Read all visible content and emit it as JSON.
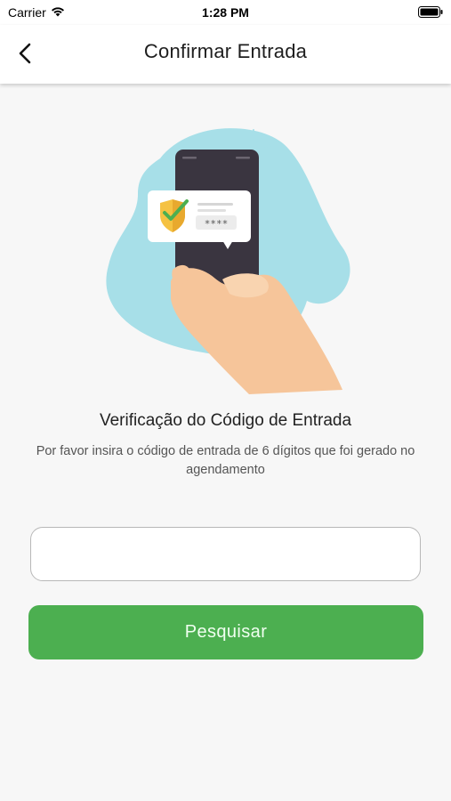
{
  "status_bar": {
    "carrier": "Carrier",
    "time": "1:28 PM",
    "wifi_icon": "wifi-icon",
    "battery_icon": "battery-icon"
  },
  "nav": {
    "back_icon": "chevron-left-icon",
    "title": "Confirmar Entrada"
  },
  "illustration": {
    "name": "phone-verification-illustration",
    "masked_code": "****"
  },
  "content": {
    "heading": "Verificação do Código de Entrada",
    "subtitle": "Por favor insira o código de entrada de 6 dígitos que foi gerado no agendamento"
  },
  "form": {
    "code_value": "",
    "code_placeholder": "",
    "button_label": "Pesquisar"
  },
  "colors": {
    "primary_button": "#4caf50",
    "blob": "#a7dfe8",
    "phone": "#3a3540",
    "shield": "#f5c242",
    "check": "#4caf50"
  }
}
